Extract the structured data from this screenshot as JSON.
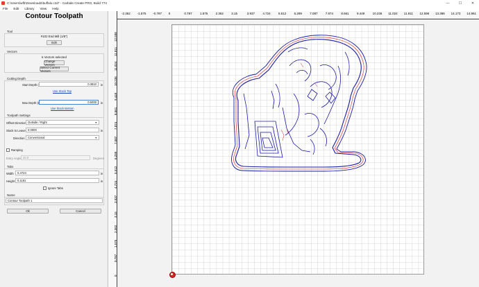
{
  "window": {
    "title": "C:\\Users\\wfb\\Downloads\\buffalo.c2d* - Carbide Create PRO, Build 774",
    "controls": [
      "—",
      "☐",
      "✕"
    ]
  },
  "menu": [
    "File",
    "Edit",
    "Library",
    "View",
    "Help"
  ],
  "panel": {
    "title": "Contour Toolpath",
    "tool": {
      "label": "Tool",
      "name": "#102 End Mill (1/8\")",
      "edit_button": "Edit"
    },
    "vectors": {
      "label": "Vectors",
      "selected": "6 Vectors selected",
      "change_button": "Change Vectors",
      "select_current_button": "Select Current Vectors"
    },
    "cutting_depth": {
      "label": "Cutting Depth",
      "start_label": "Start Depth (S)",
      "start_value": "0.3810",
      "start_unit": "in",
      "use_stock_top": "Use Stock Top",
      "max_label": "Max Depth (D)",
      "max_value": "0.5000",
      "max_unit": "in",
      "use_stock_bottom": "Use Stock Bottom"
    },
    "toolpath_settings": {
      "label": "Toolpath Settings",
      "offset_label": "Offset Direction",
      "offset_value": "Outside / Right",
      "stock_label": "Stock to Leave",
      "stock_value": "0.0000",
      "stock_unit": "in",
      "direction_label": "Direction",
      "direction_value": "Conventional",
      "ramping_label": "Ramping",
      "entry_angle_label": "Entry Angle",
      "entry_angle_value": "20.0",
      "entry_angle_unit": "Degrees"
    },
    "tabs": {
      "label": "Tabs",
      "width_label": "Width",
      "width_value": "0.4724",
      "width_unit": "in",
      "height_label": "Height",
      "height_value": "0.1181",
      "height_unit": "in",
      "ignore_label": "Ignore Tabs"
    },
    "name": {
      "label": "Name",
      "value": "Contour Toolpath 1"
    },
    "ok_button": "Ok",
    "cancel_button": "Cancel"
  },
  "ruler": {
    "top": [
      "-2.362",
      "-1.575",
      "-0.787",
      "0",
      "0.787",
      "1.575",
      "2.362",
      "3.15",
      "3.937",
      "4.724",
      "5.512",
      "6.299",
      "7.087",
      "7.874",
      "8.661",
      "9.449",
      "10.236",
      "11.024",
      "11.811",
      "12.598",
      "13.386",
      "14.173",
      "14.961"
    ],
    "left": [
      "12.598",
      "11.811",
      "11.024",
      "10.236",
      "9.449",
      "8.661",
      "7.874",
      "7.087",
      "6.299",
      "5.512",
      "4.724",
      "3.937",
      "3.15",
      "2.362",
      "1.575",
      "0.787",
      "0"
    ]
  },
  "colors": {
    "toolpath": "#1a1aa8",
    "vector": "#e02020",
    "panel_bg": "#f0f0f0",
    "link": "#1a44b8"
  },
  "icons": {
    "origin": "origin-marker-icon",
    "app": "carbide-create-icon"
  }
}
